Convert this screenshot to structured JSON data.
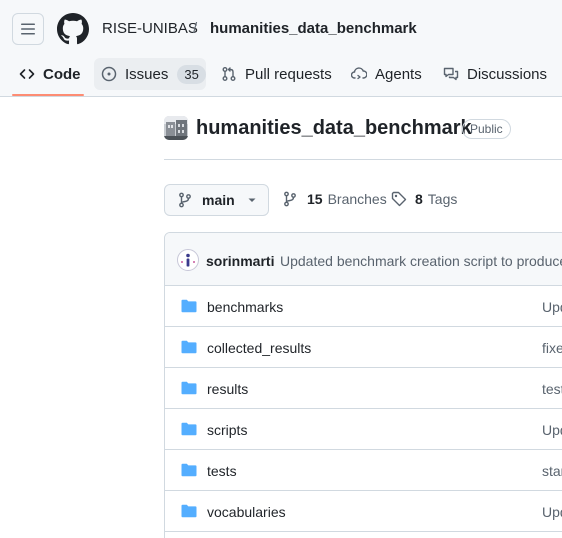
{
  "breadcrumb": {
    "owner": "RISE-UNIBAS",
    "separator": "/",
    "repo": "humanities_data_benchmark"
  },
  "nav_tabs": [
    {
      "label": "Code",
      "icon": "code-icon",
      "selected": true
    },
    {
      "label": "Issues",
      "icon": "issue-icon",
      "count": "35"
    },
    {
      "label": "Pull requests",
      "icon": "pull-request-icon"
    },
    {
      "label": "Agents",
      "icon": "agents-icon"
    },
    {
      "label": "Discussions",
      "icon": "discussions-icon"
    }
  ],
  "repo": {
    "name": "humanities_data_benchmark",
    "visibility": "Public"
  },
  "branch_bar": {
    "current_branch": "main",
    "branches_count": "15",
    "branches_label": "Branches",
    "tags_count": "8",
    "tags_label": "Tags"
  },
  "latest_commit": {
    "author": "sorinmarti",
    "message": "Updated benchmark creation script to produce"
  },
  "files": [
    {
      "name": "benchmarks",
      "type": "folder",
      "commit_message": "Upd"
    },
    {
      "name": "collected_results",
      "type": "folder",
      "commit_message": "fixe"
    },
    {
      "name": "results",
      "type": "folder",
      "commit_message": "test"
    },
    {
      "name": "scripts",
      "type": "folder",
      "commit_message": "Upd"
    },
    {
      "name": "tests",
      "type": "folder",
      "commit_message": "star"
    },
    {
      "name": "vocabularies",
      "type": "folder",
      "commit_message": "Upd"
    }
  ],
  "colors": {
    "tab_underline": "#fd8c73",
    "folder": "#54aeff",
    "header_bg": "#f6f8fa",
    "border": "#d1d9e0"
  }
}
